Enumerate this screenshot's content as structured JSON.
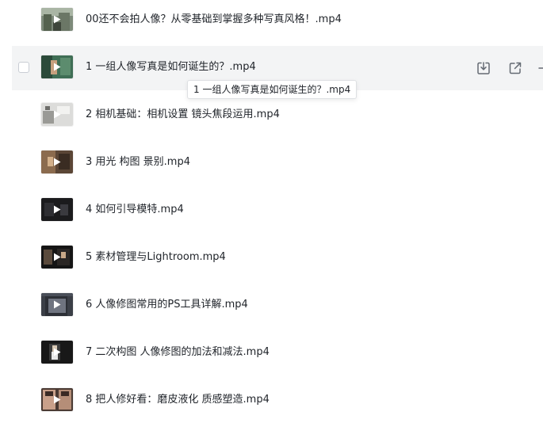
{
  "files": [
    {
      "name": "00还不会拍人像？从零基础到掌握多种写真风格！.mp4",
      "thumb": "outdoor"
    },
    {
      "name": "1 一组人像写真是如何诞生的？.mp4",
      "thumb": "green"
    },
    {
      "name": "2 相机基础：相机设置 镜头焦段运用.mp4",
      "thumb": "light"
    },
    {
      "name": "3 用光 构图 景别.mp4",
      "thumb": "warm"
    },
    {
      "name": "4 如何引导模特.mp4",
      "thumb": "dark"
    },
    {
      "name": "5 素材管理与Lightroom.mp4",
      "thumb": "dark"
    },
    {
      "name": "6 人像修图常用的PS工具详解.mp4",
      "thumb": "software"
    },
    {
      "name": "7 二次构图 人像修图的加法和减法.mp4",
      "thumb": "dark"
    },
    {
      "name": "8 把人修好看：磨皮液化 质感塑造.mp4",
      "thumb": "faces"
    }
  ],
  "hovered_row": {
    "tooltip": "1 一组人像写真是如何诞生的？.mp4",
    "actions": [
      {
        "icon": "download-icon"
      },
      {
        "icon": "share-icon"
      },
      {
        "icon": "more-icon"
      }
    ]
  },
  "colors": {
    "hover_bg": "#f3f4f5",
    "text": "#1f2329",
    "icon": "#646a73"
  }
}
